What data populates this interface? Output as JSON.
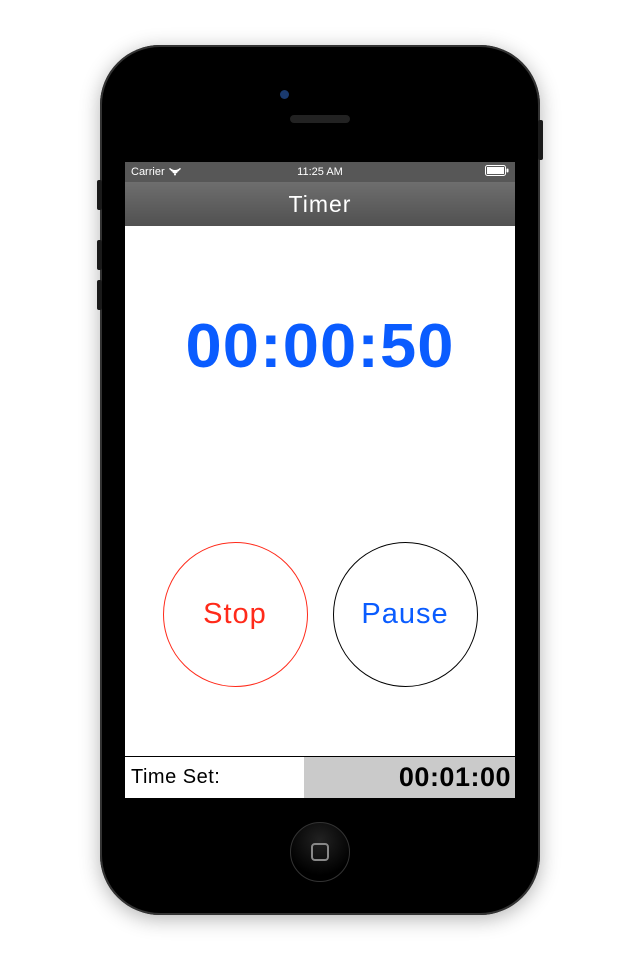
{
  "statusBar": {
    "carrier": "Carrier",
    "time": "11:25 AM"
  },
  "navBar": {
    "title": "Timer"
  },
  "timer": {
    "current": "00:00:50"
  },
  "buttons": {
    "stop": "Stop",
    "pause": "Pause"
  },
  "footer": {
    "label": "Time Set:",
    "value": "00:01:00"
  }
}
